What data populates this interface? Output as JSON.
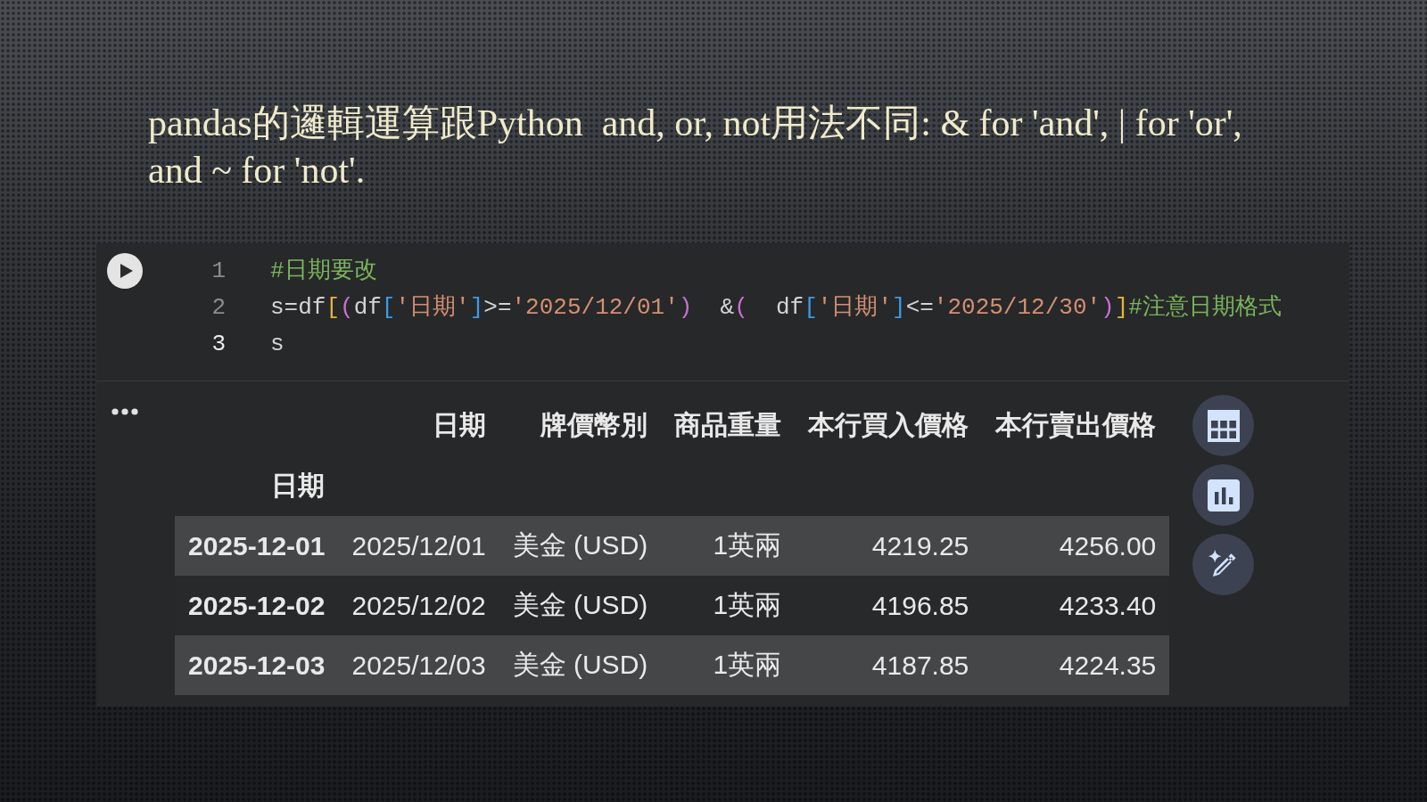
{
  "heading": "pandas的邏輯運算跟Python  and, or, not用法不同: & for 'and', | for 'or', and ~ for 'not'.",
  "code_cell": {
    "lines": [
      {
        "number": "1",
        "current": false,
        "tokens": [
          {
            "text": "#日期要改",
            "color": "#7ab55c"
          }
        ]
      },
      {
        "number": "2",
        "current": false,
        "tokens": [
          {
            "text": "s=df",
            "color": "#d4d4d4"
          },
          {
            "text": "[",
            "color": "#e6b43c"
          },
          {
            "text": "(",
            "color": "#c86fd6"
          },
          {
            "text": "df",
            "color": "#d4d4d4"
          },
          {
            "text": "[",
            "color": "#3c9be8"
          },
          {
            "text": "'日期'",
            "color": "#d49072"
          },
          {
            "text": "]",
            "color": "#3c9be8"
          },
          {
            "text": ">=",
            "color": "#d4d4d4"
          },
          {
            "text": "'2025/12/01'",
            "color": "#d49072"
          },
          {
            "text": ")",
            "color": "#c86fd6"
          },
          {
            "text": "  &",
            "color": "#d4d4d4"
          },
          {
            "text": "(",
            "color": "#c86fd6"
          },
          {
            "text": "  df",
            "color": "#d4d4d4"
          },
          {
            "text": "[",
            "color": "#3c9be8"
          },
          {
            "text": "'日期'",
            "color": "#d49072"
          },
          {
            "text": "]",
            "color": "#3c9be8"
          },
          {
            "text": "<=",
            "color": "#d4d4d4"
          },
          {
            "text": "'2025/12/30'",
            "color": "#d49072"
          },
          {
            "text": ")",
            "color": "#c86fd6"
          },
          {
            "text": "]",
            "color": "#e6b43c"
          },
          {
            "text": "#注意日期格式",
            "color": "#7ab55c"
          }
        ]
      },
      {
        "number": "3",
        "current": true,
        "tokens": [
          {
            "text": "s",
            "color": "#d4d4d4"
          }
        ]
      }
    ]
  },
  "output": {
    "table": {
      "columns": [
        "日期",
        "牌價幣別",
        "商品重量",
        "本行買入價格",
        "本行賣出價格"
      ],
      "index_name": "日期",
      "rows": [
        {
          "index": "2025-12-01",
          "cells": [
            "2025/12/01",
            "美金 (USD)",
            "1英兩",
            "4219.25",
            "4256.00"
          ]
        },
        {
          "index": "2025-12-02",
          "cells": [
            "2025/12/02",
            "美金 (USD)",
            "1英兩",
            "4196.85",
            "4233.40"
          ]
        },
        {
          "index": "2025-12-03",
          "cells": [
            "2025/12/03",
            "美金 (USD)",
            "1英兩",
            "4187.85",
            "4224.35"
          ]
        }
      ]
    }
  }
}
